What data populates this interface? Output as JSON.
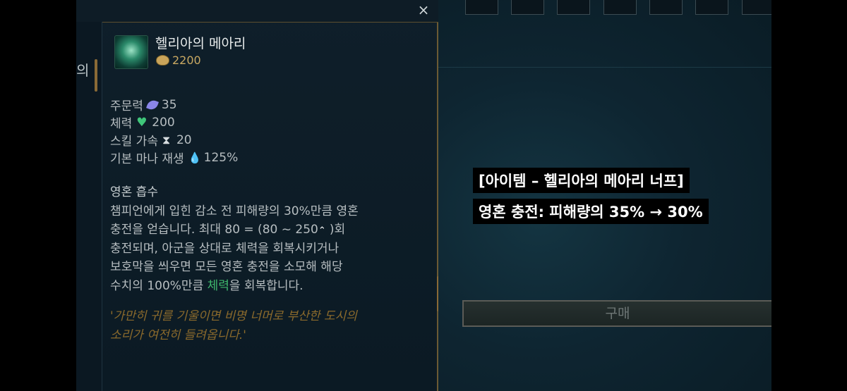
{
  "tooltip": {
    "close_label": "×",
    "sidebar_text": "의",
    "item": {
      "name": "헬리아의 메아리",
      "price": "2200",
      "icon": "helia-echo-item-icon"
    },
    "stats": [
      {
        "label": "주문력",
        "icon": "ability-power-icon",
        "value": "35"
      },
      {
        "label": "체력",
        "icon": "health-icon",
        "value": "200"
      },
      {
        "label": "스킬 가속",
        "icon": "ability-haste-icon",
        "value": "20"
      },
      {
        "label": "기본 마나 재생",
        "icon": "mana-regen-icon",
        "value": "125%"
      }
    ],
    "passive": {
      "title": "영혼 흡수",
      "line1": "챔피언에게 입힌 감소 전 피해량의 30%만큼 영혼",
      "line2a": "충전을 얻습니다. 최대 80 = (80 ~ 250",
      "line2b": ")회",
      "line3": "충전되며, 아군을 상대로 체력을 회복시키거나",
      "line4": "보호막을 씌우면 모든 영혼 충전을 소모해 해당",
      "line5a": "수치의 100%만큼 ",
      "line5_highlight": "체력",
      "line5b": "을 회복합니다."
    },
    "flavor": {
      "line1": "'가만히 귀를 기울이면 비명 너머로 부산한 도시의",
      "line2": "소리가 여전히 들려옵니다.'"
    }
  },
  "shop": {
    "buy_label": "구매"
  },
  "caption": {
    "line1": "[아이템 – 헬리아의 메아리 너프]",
    "line2": "영혼 충전: 피해량의 35% → 30%"
  },
  "colors": {
    "gold": "#c8a862",
    "health": "#3fb86d",
    "flavor": "#8b6a2c",
    "border_gold": "#6b5a34"
  }
}
